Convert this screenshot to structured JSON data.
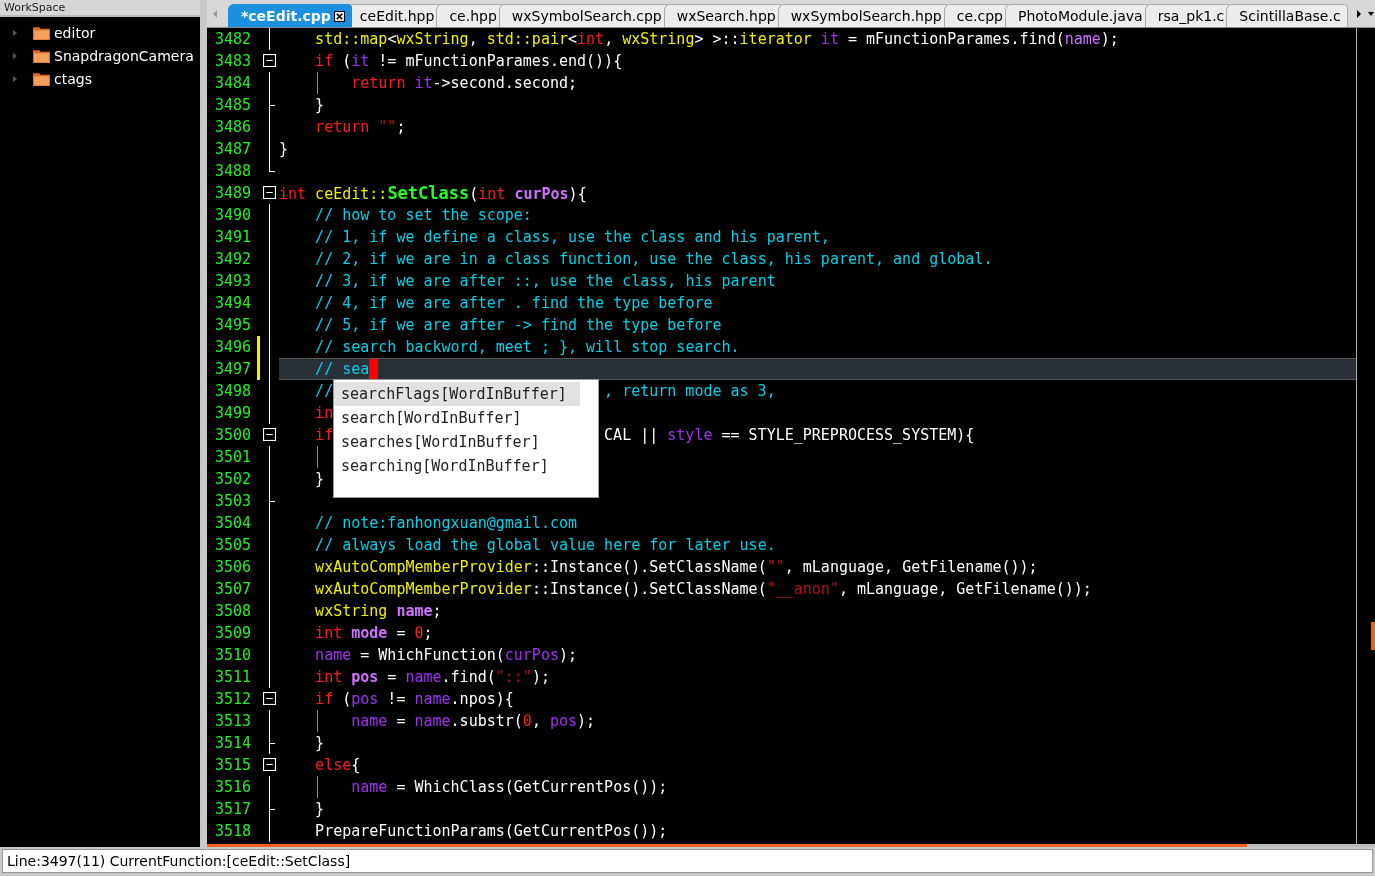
{
  "workspace": {
    "title": "WorkSpace",
    "items": [
      {
        "label": "editor",
        "expanded": false
      },
      {
        "label": "SnapdragonCamera",
        "expanded": false
      },
      {
        "label": "ctags",
        "expanded": false
      }
    ]
  },
  "tabs": [
    {
      "label": "*ceEdit.cpp",
      "selected": true
    },
    {
      "label": "ceEdit.hpp",
      "selected": false
    },
    {
      "label": "ce.hpp",
      "selected": false
    },
    {
      "label": "wxSymbolSearch.cpp",
      "selected": false
    },
    {
      "label": "wxSearch.hpp",
      "selected": false
    },
    {
      "label": "wxSymbolSearch.hpp",
      "selected": false
    },
    {
      "label": "ce.cpp",
      "selected": false
    },
    {
      "label": "PhotoModule.java",
      "selected": false
    },
    {
      "label": "rsa_pk1.c",
      "selected": false
    },
    {
      "label": "ScintillaBase.c",
      "selected": false
    }
  ],
  "lines": [
    {
      "number": "3482",
      "kind": "line",
      "changed": false,
      "current": false,
      "guide": false,
      "tokens": [
        {
          "text": "    std::map",
          "kind": "type"
        },
        {
          "text": "<",
          "kind": "plain"
        },
        {
          "text": "wxString",
          "kind": "type"
        },
        {
          "text": ", ",
          "kind": "plain"
        },
        {
          "text": "std::pair",
          "kind": "type"
        },
        {
          "text": "<",
          "kind": "plain"
        },
        {
          "text": "int",
          "kind": "keyword"
        },
        {
          "text": ", ",
          "kind": "plain"
        },
        {
          "text": "wxString",
          "kind": "type"
        },
        {
          "text": "> >::",
          "kind": "plain"
        },
        {
          "text": "iterator",
          "kind": "type"
        },
        {
          "text": " it",
          "kind": "var"
        },
        {
          "text": " = mFunctionParames.find(",
          "kind": "plain"
        },
        {
          "text": "name",
          "kind": "param"
        },
        {
          "text": ");",
          "kind": "plain"
        }
      ]
    },
    {
      "number": "3483",
      "kind": "box",
      "changed": false,
      "current": false,
      "guide": false,
      "tokens": [
        {
          "text": "    if",
          "kind": "keyword"
        },
        {
          "text": " (",
          "kind": "plain"
        },
        {
          "text": "it",
          "kind": "var"
        },
        {
          "text": " != mFunctionParames.end()){",
          "kind": "plain"
        }
      ]
    },
    {
      "number": "3484",
      "kind": "line",
      "changed": false,
      "current": false,
      "guide": true,
      "tokens": [
        {
          "text": "        return",
          "kind": "keyword"
        },
        {
          "text": " it",
          "kind": "var"
        },
        {
          "text": "->second.second;",
          "kind": "plain"
        }
      ]
    },
    {
      "number": "3485",
      "kind": "tick",
      "changed": false,
      "current": false,
      "guide": false,
      "tokens": [
        {
          "text": "    }",
          "kind": "plain"
        }
      ]
    },
    {
      "number": "3486",
      "kind": "line",
      "changed": false,
      "current": false,
      "guide": false,
      "tokens": [
        {
          "text": "    return",
          "kind": "keyword"
        },
        {
          "text": " \"\"",
          "kind": "string"
        },
        {
          "text": ";",
          "kind": "plain"
        }
      ]
    },
    {
      "number": "3487",
      "kind": "line",
      "changed": false,
      "current": false,
      "guide": false,
      "tokens": [
        {
          "text": "}",
          "kind": "plain"
        }
      ]
    },
    {
      "number": "3488",
      "kind": "corner",
      "changed": false,
      "current": false,
      "guide": false
    },
    {
      "number": "3489",
      "kind": "box",
      "changed": false,
      "current": false,
      "guide": false,
      "tokens": [
        {
          "text": "int",
          "kind": "keyword"
        },
        {
          "text": " ceEdit::",
          "kind": "type"
        },
        {
          "text": "SetClass",
          "kind": "func"
        },
        {
          "text": "(",
          "kind": "plain"
        },
        {
          "text": "int",
          "kind": "keyword"
        },
        {
          "text": " curPos",
          "kind": "decl"
        },
        {
          "text": "){",
          "kind": "plain"
        }
      ]
    },
    {
      "number": "3490",
      "kind": "line",
      "changed": false,
      "current": false,
      "guide": false,
      "tokens": [
        {
          "text": "    // how to set the scope:",
          "kind": "comment"
        }
      ]
    },
    {
      "number": "3491",
      "kind": "line",
      "changed": false,
      "current": false,
      "guide": false,
      "tokens": [
        {
          "text": "    // 1, if we define a class, use the class and his parent,",
          "kind": "comment"
        }
      ]
    },
    {
      "number": "3492",
      "kind": "line",
      "changed": false,
      "current": false,
      "guide": false,
      "tokens": [
        {
          "text": "    // 2, if we are in a class function, use the class, his parent, and global.",
          "kind": "comment"
        }
      ]
    },
    {
      "number": "3493",
      "kind": "line",
      "changed": false,
      "current": false,
      "guide": false,
      "tokens": [
        {
          "text": "    // 3, if we are after ::, use the class, his parent",
          "kind": "comment"
        }
      ]
    },
    {
      "number": "3494",
      "kind": "line",
      "changed": false,
      "current": false,
      "guide": false,
      "tokens": [
        {
          "text": "    // 4, if we are after . find the type before",
          "kind": "comment"
        }
      ]
    },
    {
      "number": "3495",
      "kind": "line",
      "changed": false,
      "current": false,
      "guide": false,
      "tokens": [
        {
          "text": "    // 5, if we are after -> find the type before",
          "kind": "comment"
        }
      ]
    },
    {
      "number": "3496",
      "kind": "line",
      "changed": true,
      "current": false,
      "guide": false,
      "tokens": [
        {
          "text": "    // search backword, meet ; }, will stop search.",
          "kind": "comment"
        }
      ]
    },
    {
      "number": "3497",
      "kind": "line",
      "changed": true,
      "current": true,
      "guide": false,
      "tokens": [
        {
          "text": "    // sea",
          "kind": "comment"
        }
      ]
    },
    {
      "number": "3498",
      "kind": "line",
      "changed": false,
      "current": false,
      "guide": false,
      "tokens": [
        {
          "text": "    //",
          "kind": "comment"
        }
      ],
      "tail": [
        {
          "text": ", return mode as 3,",
          "kind": "comment"
        }
      ]
    },
    {
      "number": "3499",
      "kind": "line",
      "changed": false,
      "current": false,
      "guide": false,
      "tokens": [
        {
          "text": "    in",
          "kind": "keyword"
        }
      ]
    },
    {
      "number": "3500",
      "kind": "box",
      "changed": false,
      "current": false,
      "guide": false,
      "tokens": [
        {
          "text": "    if",
          "kind": "keyword"
        }
      ],
      "tail": [
        {
          "text": "CAL || ",
          "kind": "plain"
        },
        {
          "text": "style",
          "kind": "var"
        },
        {
          "text": " == STYLE_PREPROCESS_SYSTEM){",
          "kind": "plain"
        }
      ]
    },
    {
      "number": "3501",
      "kind": "line",
      "changed": false,
      "current": false,
      "guide": true
    },
    {
      "number": "3502",
      "kind": "line",
      "changed": false,
      "current": false,
      "guide": false,
      "tokens": [
        {
          "text": "    }",
          "kind": "plain"
        }
      ]
    },
    {
      "number": "3503",
      "kind": "tick",
      "changed": false,
      "current": false,
      "guide": false
    },
    {
      "number": "3504",
      "kind": "line",
      "changed": false,
      "current": false,
      "guide": false,
      "tokens": [
        {
          "text": "    // note:fanhongxuan@gmail.com",
          "kind": "comment"
        }
      ]
    },
    {
      "number": "3505",
      "kind": "line",
      "changed": false,
      "current": false,
      "guide": false,
      "tokens": [
        {
          "text": "    // always load the global value here for later use.",
          "kind": "comment"
        }
      ]
    },
    {
      "number": "3506",
      "kind": "line",
      "changed": false,
      "current": false,
      "guide": false,
      "tokens": [
        {
          "text": "    wxAutoCompMemberProvider",
          "kind": "type"
        },
        {
          "text": "::Instance().SetClassName(",
          "kind": "plain"
        },
        {
          "text": "\"\"",
          "kind": "string"
        },
        {
          "text": ", mLanguage, GetFilename());",
          "kind": "plain"
        }
      ]
    },
    {
      "number": "3507",
      "kind": "line",
      "changed": false,
      "current": false,
      "guide": false,
      "tokens": [
        {
          "text": "    wxAutoCompMemberProvider",
          "kind": "type"
        },
        {
          "text": "::Instance().SetClassName(",
          "kind": "plain"
        },
        {
          "text": "\"__anon\"",
          "kind": "string"
        },
        {
          "text": ", mLanguage, GetFilename());",
          "kind": "plain"
        }
      ]
    },
    {
      "number": "3508",
      "kind": "line",
      "changed": false,
      "current": false,
      "guide": false,
      "tokens": [
        {
          "text": "    wxString",
          "kind": "type"
        },
        {
          "text": " name",
          "kind": "decl"
        },
        {
          "text": ";",
          "kind": "plain"
        }
      ]
    },
    {
      "number": "3509",
      "kind": "line",
      "changed": false,
      "current": false,
      "guide": false,
      "tokens": [
        {
          "text": "    int",
          "kind": "keyword"
        },
        {
          "text": " mode",
          "kind": "decl"
        },
        {
          "text": " = ",
          "kind": "plain"
        },
        {
          "text": "0",
          "kind": "number"
        },
        {
          "text": ";",
          "kind": "plain"
        }
      ]
    },
    {
      "number": "3510",
      "kind": "line",
      "changed": false,
      "current": false,
      "guide": false,
      "tokens": [
        {
          "text": "    name",
          "kind": "var"
        },
        {
          "text": " = WhichFunction(",
          "kind": "plain"
        },
        {
          "text": "curPos",
          "kind": "var"
        },
        {
          "text": ");",
          "kind": "plain"
        }
      ]
    },
    {
      "number": "3511",
      "kind": "line",
      "changed": false,
      "current": false,
      "guide": false,
      "tokens": [
        {
          "text": "    int",
          "kind": "keyword"
        },
        {
          "text": " pos",
          "kind": "decl"
        },
        {
          "text": " = ",
          "kind": "plain"
        },
        {
          "text": "name",
          "kind": "var"
        },
        {
          "text": ".find(",
          "kind": "plain"
        },
        {
          "text": "\"::\"",
          "kind": "string"
        },
        {
          "text": ");",
          "kind": "plain"
        }
      ]
    },
    {
      "number": "3512",
      "kind": "box",
      "changed": false,
      "current": false,
      "guide": false,
      "tokens": [
        {
          "text": "    if",
          "kind": "keyword"
        },
        {
          "text": " (",
          "kind": "plain"
        },
        {
          "text": "pos",
          "kind": "var"
        },
        {
          "text": " != ",
          "kind": "plain"
        },
        {
          "text": "name",
          "kind": "var"
        },
        {
          "text": ".npos){",
          "kind": "plain"
        }
      ]
    },
    {
      "number": "3513",
      "kind": "line",
      "changed": false,
      "current": false,
      "guide": true,
      "tokens": [
        {
          "text": "        name",
          "kind": "var"
        },
        {
          "text": " = ",
          "kind": "plain"
        },
        {
          "text": "name",
          "kind": "var"
        },
        {
          "text": ".substr(",
          "kind": "plain"
        },
        {
          "text": "0",
          "kind": "number"
        },
        {
          "text": ", ",
          "kind": "plain"
        },
        {
          "text": "pos",
          "kind": "var"
        },
        {
          "text": ");",
          "kind": "plain"
        }
      ]
    },
    {
      "number": "3514",
      "kind": "tick",
      "changed": false,
      "current": false,
      "guide": false,
      "tokens": [
        {
          "text": "    }",
          "kind": "plain"
        }
      ]
    },
    {
      "number": "3515",
      "kind": "box",
      "changed": false,
      "current": false,
      "guide": false,
      "tokens": [
        {
          "text": "    else",
          "kind": "keyword"
        },
        {
          "text": "{",
          "kind": "plain"
        }
      ]
    },
    {
      "number": "3516",
      "kind": "line",
      "changed": false,
      "current": false,
      "guide": true,
      "tokens": [
        {
          "text": "        name",
          "kind": "var"
        },
        {
          "text": " = WhichClass(GetCurrentPos());",
          "kind": "plain"
        }
      ]
    },
    {
      "number": "3517",
      "kind": "tick",
      "changed": false,
      "current": false,
      "guide": false,
      "tokens": [
        {
          "text": "    }",
          "kind": "plain"
        }
      ]
    },
    {
      "number": "3518",
      "kind": "line",
      "changed": false,
      "current": false,
      "guide": false,
      "tokens": [
        {
          "text": "    PrepareFunctionParams(GetCurrentPos());",
          "kind": "plain"
        }
      ]
    }
  ],
  "autocomplete": [
    {
      "label": "searchFlags[WordInBuffer]",
      "selected": true
    },
    {
      "label": "search[WordInBuffer]",
      "selected": false
    },
    {
      "label": "searches[WordInBuffer]",
      "selected": false
    },
    {
      "label": "searching[WordInBuffer]",
      "selected": false
    }
  ],
  "status_bar": "Line:3497(11) CurrentFunction:[ceEdit::SetClass]"
}
